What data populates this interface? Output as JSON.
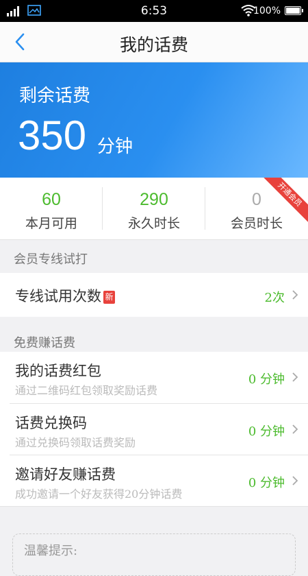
{
  "status_bar": {
    "time": "6:53",
    "battery": "100%",
    "icons": [
      "signal-icon",
      "image-icon",
      "wifi-icon",
      "battery-icon"
    ]
  },
  "nav": {
    "title": "我的话费",
    "back_icon": "chevron-left-icon"
  },
  "balance": {
    "label": "剩余话费",
    "amount": "350",
    "unit": "分钟"
  },
  "stats": [
    {
      "value": "60",
      "caption": "本月可用",
      "color": "#4cbb2e"
    },
    {
      "value": "290",
      "caption": "永久时长",
      "color": "#4cbb2e"
    },
    {
      "value": "0",
      "caption": "会员时长",
      "color": "#aaaaaa"
    }
  ],
  "ribbon": "开通会员",
  "section_member": {
    "header": "会员专线试打",
    "row": {
      "title": "专线试用次数",
      "badge": "新",
      "value": "2次"
    }
  },
  "section_earn": {
    "header": "免费赚话费",
    "rows": [
      {
        "title": "我的话费红包",
        "subtitle": "通过二维码红包领取奖励话费",
        "value": "0 分钟"
      },
      {
        "title": "话费兑换码",
        "subtitle": "通过兑换码领取话费奖励",
        "value": "0 分钟"
      },
      {
        "title": "邀请好友赚话费",
        "subtitle": "成功邀请一个好友获得20分钟话费",
        "value": "0 分钟"
      }
    ]
  },
  "tip_box": {
    "label": "温馨提示:"
  },
  "colors": {
    "accent_blue": "#2a8ff0",
    "green": "#4cbb2e",
    "red": "#e8423c"
  }
}
